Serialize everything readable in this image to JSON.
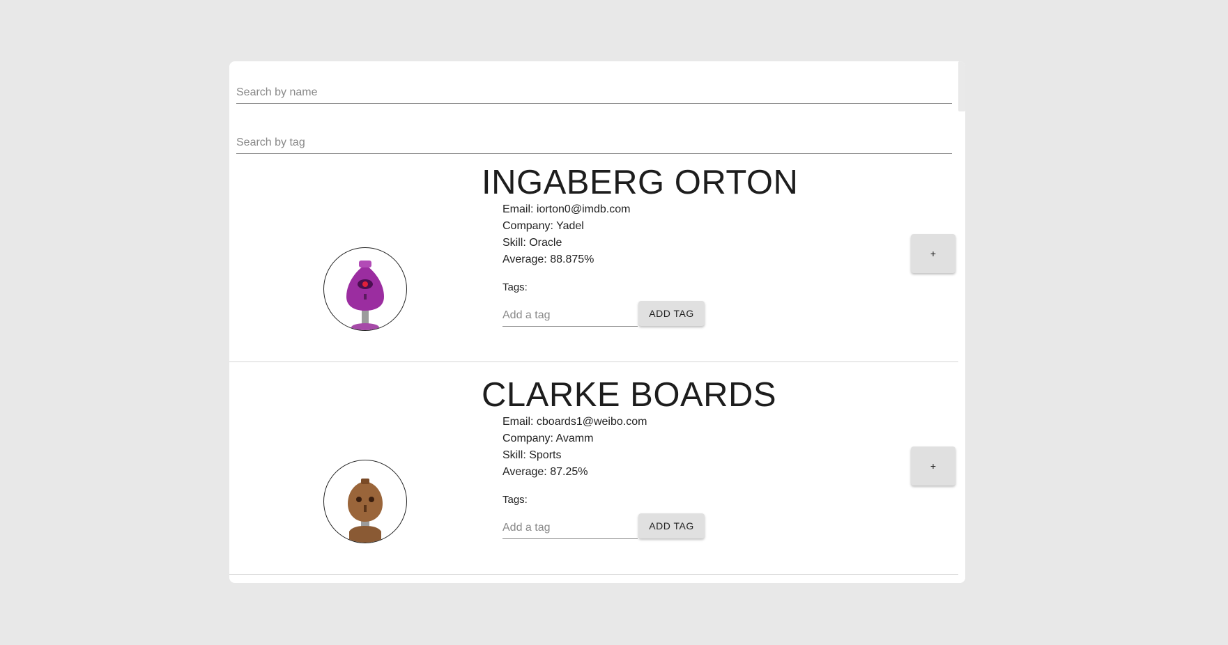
{
  "search": {
    "name_placeholder": "Search by name",
    "tag_placeholder": "Search by tag"
  },
  "students": [
    {
      "name": "INGABERG ORTON",
      "email": "Email: iorton0@imdb.com",
      "company": "Company: Yadel",
      "skill": "Skill: Oracle",
      "average": "Average: 88.875%",
      "tags_label": "Tags:",
      "tag_placeholder": "Add a tag",
      "add_tag_label": "ADD TAG",
      "expand_label": "+",
      "avatar_color": "#9b2da0",
      "avatar_icon": "purple-robot-avatar"
    },
    {
      "name": "CLARKE BOARDS",
      "email": "Email: cboards1@weibo.com",
      "company": "Company: Avamm",
      "skill": "Skill: Sports",
      "average": "Average: 87.25%",
      "tags_label": "Tags:",
      "tag_placeholder": "Add a tag",
      "add_tag_label": "ADD TAG",
      "expand_label": "+",
      "avatar_color": "#8a5a34",
      "avatar_icon": "brown-robot-avatar"
    }
  ]
}
